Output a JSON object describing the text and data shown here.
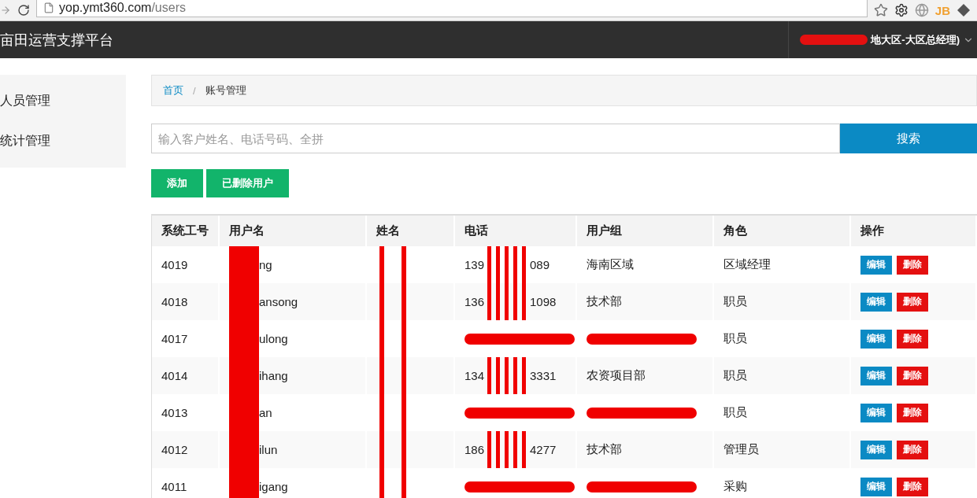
{
  "browser": {
    "url_host": "yop.ymt360.com",
    "url_path": "/users",
    "extension_label": "JB"
  },
  "navbar": {
    "title": "亩田运营支撑平台",
    "user_visible": "地大区-大区总经理)"
  },
  "sidebar": {
    "items": [
      {
        "label": "人员管理"
      },
      {
        "label": "统计管理"
      }
    ]
  },
  "breadcrumb": [
    {
      "label": "首页",
      "kind": "link"
    },
    {
      "label": "账号管理",
      "kind": "current"
    }
  ],
  "breadcrumb_separator": "/",
  "search": {
    "placeholder": "输入客户姓名、电话号码、全拼",
    "button": "搜索"
  },
  "actions": [
    "添加",
    "已删除用户"
  ],
  "table": {
    "columns": [
      "系统工号",
      "用户名",
      "姓名",
      "电话",
      "用户组",
      "角色",
      "操作"
    ],
    "rows": [
      {
        "id": "4019",
        "username": "ng",
        "phone": {
          "kind": "partial",
          "head": "139",
          "tail": "089"
        },
        "group": "海南区域",
        "role": "区域经理",
        "edit": "编辑",
        "delete": "删除"
      },
      {
        "id": "4018",
        "username": "ansong",
        "phone": {
          "kind": "partial",
          "head": "136",
          "tail": "1098"
        },
        "group": "技术部",
        "role": "职员",
        "edit": "编辑",
        "delete": "删除"
      },
      {
        "id": "4017",
        "username": "ulong",
        "phone": {
          "kind": "struck"
        },
        "role": "职员",
        "edit": "编辑",
        "delete": "删除"
      },
      {
        "id": "4014",
        "username": "ihang",
        "phone": {
          "kind": "partial",
          "head": "134",
          "tail": "3331"
        },
        "group": "农资项目部",
        "role": "职员",
        "edit": "编辑",
        "delete": "删除"
      },
      {
        "id": "4013",
        "username": "an",
        "phone": {
          "kind": "struck"
        },
        "role": "职员",
        "edit": "编辑",
        "delete": "删除"
      },
      {
        "id": "4012",
        "username": "ilun",
        "phone": {
          "kind": "partial",
          "head": "186",
          "tail": "4277"
        },
        "group": "技术部",
        "role": "管理员",
        "edit": "编辑",
        "delete": "删除"
      },
      {
        "id": "4011",
        "username": "igang",
        "phone": {
          "kind": "struck"
        },
        "role": "采购",
        "edit": "编辑",
        "delete": "删除"
      }
    ]
  }
}
